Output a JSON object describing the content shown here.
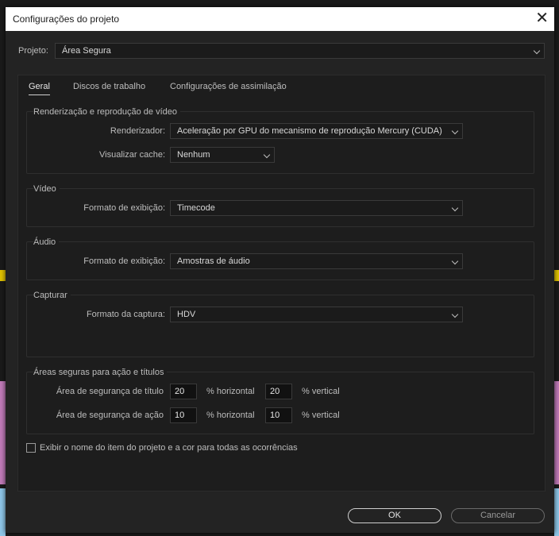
{
  "window": {
    "title": "Configurações do projeto"
  },
  "project": {
    "label": "Projeto:",
    "value": "Área Segura"
  },
  "tabs": [
    {
      "label": "Geral"
    },
    {
      "label": "Discos de trabalho"
    },
    {
      "label": "Configurações de assimilação"
    }
  ],
  "render": {
    "title": "Renderização e reprodução de vídeo",
    "renderer_label": "Renderizador:",
    "renderer_value": "Aceleração por GPU do mecanismo de reprodução Mercury (CUDA)",
    "preview_label": "Visualizar cache:",
    "preview_value": "Nenhum"
  },
  "video": {
    "title": "Vídeo",
    "format_label": "Formato de exibição:",
    "format_value": "Timecode"
  },
  "audio": {
    "title": "Áudio",
    "format_label": "Formato de exibição:",
    "format_value": "Amostras de áudio"
  },
  "capture": {
    "title": "Capturar",
    "format_label": "Formato da captura:",
    "format_value": "HDV"
  },
  "safe": {
    "title": "Áreas seguras para ação e títulos",
    "title_label": "Área de segurança de título",
    "title_h": "20",
    "title_v": "20",
    "action_label": "Área de segurança de ação",
    "action_h": "10",
    "action_v": "10",
    "h_unit": "% horizontal",
    "v_unit": "% vertical"
  },
  "checkbox": {
    "label": "Exibir o nome do item do projeto e a cor para todas as ocorrências"
  },
  "buttons": {
    "ok": "OK",
    "cancel": "Cancelar"
  }
}
